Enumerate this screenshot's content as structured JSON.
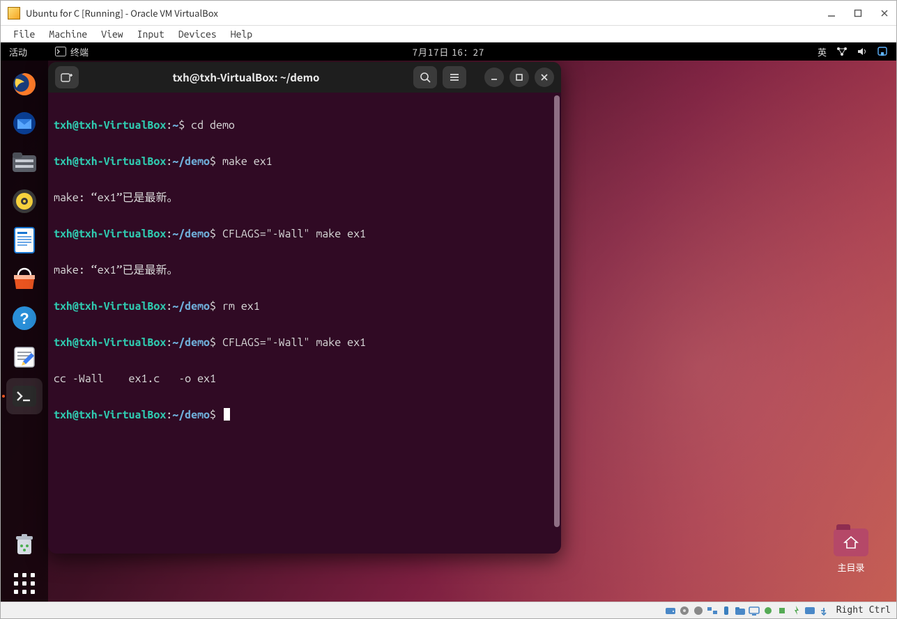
{
  "vbox": {
    "title": "Ubuntu for C [Running] - Oracle VM VirtualBox",
    "menu": {
      "file": "File",
      "machine": "Machine",
      "view": "View",
      "input": "Input",
      "devices": "Devices",
      "help": "Help"
    },
    "host_key": "Right Ctrl"
  },
  "ubuntu": {
    "activities": "活动",
    "terminal_indicator": "终端",
    "clock": "7月17日  16：27",
    "ime": "英",
    "desktop_folder_label": "主目录"
  },
  "terminal": {
    "title": "txh@txh-VirtualBox: ~/demo",
    "prompt_user": "txh@txh-VirtualBox",
    "prompt_home": "~",
    "prompt_demo": "~/demo",
    "lines": {
      "cmd1": "cd demo",
      "cmd2": "make ex1",
      "out2": "make: “ex1”已是最新。",
      "cmd3": "CFLAGS=\"-Wall\" make ex1",
      "out3": "make: “ex1”已是最新。",
      "cmd4": "rm ex1",
      "cmd5": "CFLAGS=\"-Wall\" make ex1",
      "out5": "cc -Wall    ex1.c   -o ex1"
    }
  },
  "dock": {
    "items": [
      "firefox",
      "thunderbird",
      "files",
      "rhythmbox",
      "writer",
      "software",
      "help",
      "text-editor",
      "terminal",
      "trash"
    ]
  }
}
